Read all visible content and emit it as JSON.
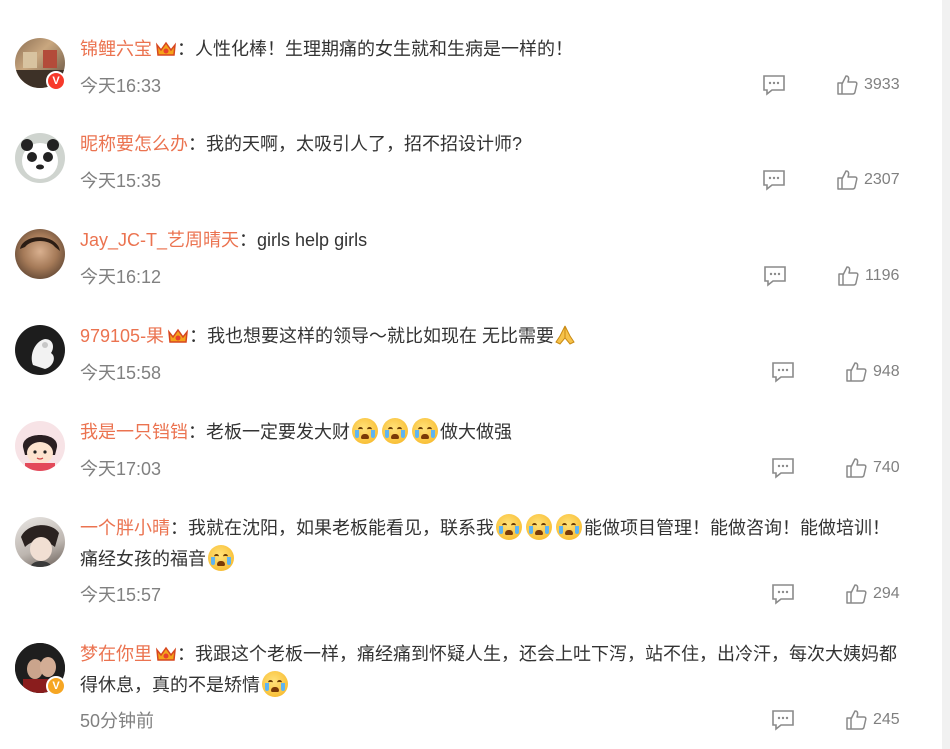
{
  "comments": [
    {
      "name": "锦鲤六宝",
      "has_crown": true,
      "text": "人性化棒！生理期痛的女生就和生病是一样的！",
      "time": "今天16:33",
      "likes": "3933",
      "badge": "V",
      "badge_color": "#f7392a"
    },
    {
      "name": "昵称要怎么办",
      "has_crown": false,
      "text": "我的天啊，太吸引人了，招不招设计师?",
      "time": "今天15:35",
      "likes": "2307"
    },
    {
      "name": "Jay_JC-T_艺周晴天",
      "has_crown": false,
      "text": "girls help girls",
      "time": "今天16:12",
      "likes": "1196"
    },
    {
      "name": "979105-果",
      "has_crown": true,
      "text": "我也想要这样的领导～就比如现在 无比需要",
      "time": "今天15:58",
      "likes": "948"
    },
    {
      "name": "我是一只铛铛",
      "has_crown": false,
      "text": "老板一定要发大财",
      "text_after": "做大做强",
      "time": "今天17:03",
      "likes": "740"
    },
    {
      "name": "一个胖小晴",
      "has_crown": false,
      "text": "我就在沈阳，如果老板能看见，联系我",
      "text_after": "能做项目管理！能做咨询！能做培训！痛经女孩的福音",
      "time": "今天15:57",
      "likes": "294"
    },
    {
      "name": "梦在你里",
      "has_crown": true,
      "text": "我跟这个老板一样，痛经痛到怀疑人生，还会上吐下泻，站不住，出冷汗，每次大姨妈都得休息，真的不是矫情",
      "time": "50分钟前",
      "likes": "245",
      "badge": "V",
      "badge_color": "#f6a623"
    }
  ],
  "separator": "："
}
